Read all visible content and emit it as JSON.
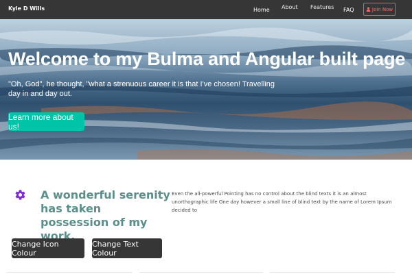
{
  "navbar": {
    "brand": "Kyle D Wills",
    "links": [
      "Home",
      "About",
      "Features",
      "FAQ"
    ],
    "join_label": "Join Now",
    "join_icon": "user-icon"
  },
  "hero": {
    "title": "Welcome to my Bulma and Angular built page",
    "subtitle": "\"Oh, God\", he thought, \"what a strenuous career it is that I've chosen! Travelling day in and day out.",
    "button_label": "Learn more about us!"
  },
  "feature": {
    "icon": "cog-icon",
    "icon_color": "#7b2fd6",
    "title": "A wonderful serenity has taken possession of my work.",
    "title_color": "#5a8f8c",
    "text": "Even the all-powerful Pointing has no control about the blind texts it is an almost unorthographic life One day however a small line of blind text by the name of Lorem Ipsum decided to"
  },
  "actions": {
    "change_icon": "Change Icon Colour",
    "change_text": "Change Text Colour"
  },
  "colors": {
    "navbar": "#363636",
    "accent": "#00c4a7",
    "danger": "#e85a5a"
  }
}
